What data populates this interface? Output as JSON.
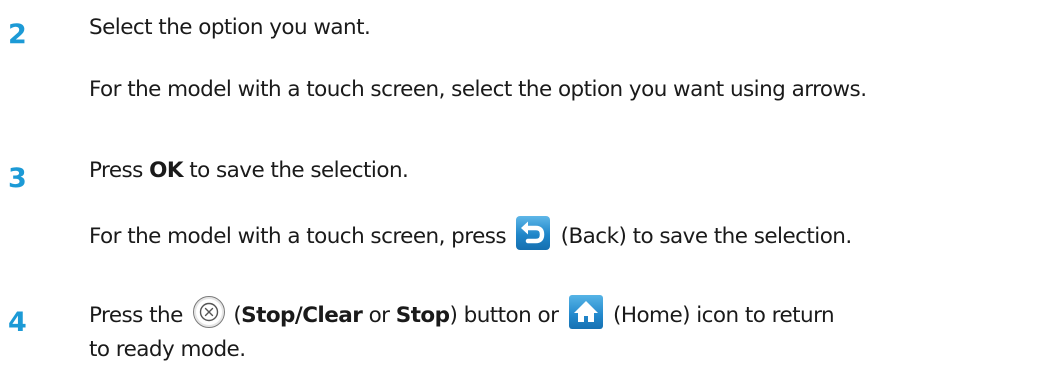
{
  "steps": [
    {
      "number": "2",
      "text": "Select the option you want.",
      "note": "For the model with a touch screen, select the option you want using arrows."
    },
    {
      "number": "3",
      "text_prefix": "Press ",
      "text_bold": "OK",
      "text_suffix": " to save the selection.",
      "note_prefix": "For the model with a touch screen, press ",
      "note_suffix": " (Back) to save the selection."
    },
    {
      "number": "4",
      "text_prefix": "Press the ",
      "paren_open": " (",
      "bold_1": "Stop/Clear",
      "or_text": " or ",
      "bold_2": "Stop",
      "after_stop": ") button or ",
      "after_home": " (Home) icon to return",
      "line2": "to ready mode."
    }
  ],
  "icons": {
    "back": "back-arrow-icon",
    "stop": "stop-clear-icon",
    "home": "home-icon"
  },
  "colors": {
    "step_number": "#1c9ad6",
    "icon_blue": "#1f86c9",
    "text": "#1a1a1a"
  }
}
